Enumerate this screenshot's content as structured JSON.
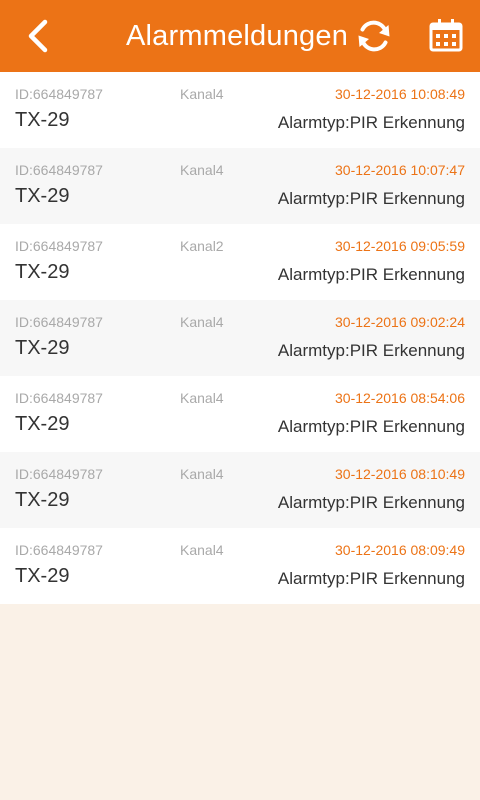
{
  "header": {
    "title": "Alarmmeldungen",
    "back_icon": "chevron-left-icon",
    "refresh_icon": "refresh-icon",
    "calendar_icon": "calendar-icon",
    "color": "#ec7316"
  },
  "alarms": [
    {
      "id": "ID:664849787",
      "channel": "Kanal4",
      "time": "30-12-2016 10:08:49",
      "device": "TX-29",
      "type": "Alarmtyp:PIR Erkennung"
    },
    {
      "id": "ID:664849787",
      "channel": "Kanal4",
      "time": "30-12-2016 10:07:47",
      "device": "TX-29",
      "type": "Alarmtyp:PIR Erkennung"
    },
    {
      "id": "ID:664849787",
      "channel": "Kanal2",
      "time": "30-12-2016 09:05:59",
      "device": "TX-29",
      "type": "Alarmtyp:PIR Erkennung"
    },
    {
      "id": "ID:664849787",
      "channel": "Kanal4",
      "time": "30-12-2016 09:02:24",
      "device": "TX-29",
      "type": "Alarmtyp:PIR Erkennung"
    },
    {
      "id": "ID:664849787",
      "channel": "Kanal4",
      "time": "30-12-2016 08:54:06",
      "device": "TX-29",
      "type": "Alarmtyp:PIR Erkennung"
    },
    {
      "id": "ID:664849787",
      "channel": "Kanal4",
      "time": "30-12-2016 08:10:49",
      "device": "TX-29",
      "type": "Alarmtyp:PIR Erkennung"
    },
    {
      "id": "ID:664849787",
      "channel": "Kanal4",
      "time": "30-12-2016 08:09:49",
      "device": "TX-29",
      "type": "Alarmtyp:PIR Erkennung"
    }
  ]
}
